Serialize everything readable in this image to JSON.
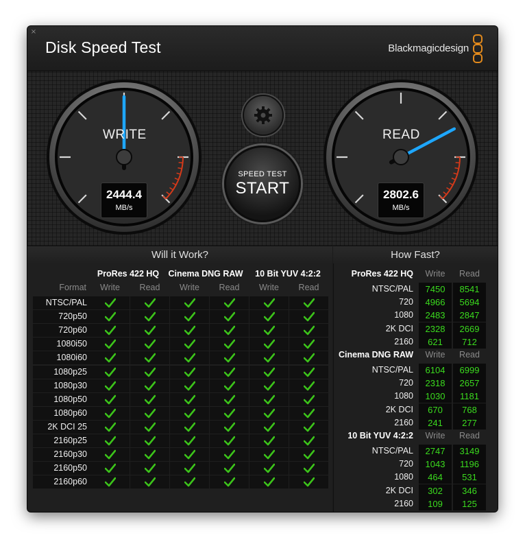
{
  "window": {
    "title": "Disk Speed Test",
    "brand": "Blackmagicdesign",
    "close_glyph": "×"
  },
  "colors": {
    "accent_needle": "#1ea7ff",
    "value_green": "#3bdb1e",
    "check_green": "#3cc31a",
    "redline": "#d53a1a"
  },
  "gauges": {
    "write": {
      "label": "WRITE",
      "value": "2444.4",
      "unit": "MB/s",
      "needle_fraction": 0.5
    },
    "read": {
      "label": "READ",
      "value": "2802.6",
      "unit": "MB/s",
      "needle_fraction": 0.73
    }
  },
  "controls": {
    "settings_icon": "gear-icon",
    "start_sub": "SPEED TEST",
    "start_main": "START"
  },
  "will_it_work": {
    "title": "Will it Work?",
    "groups": [
      "ProRes 422 HQ",
      "Cinema DNG RAW",
      "10 Bit YUV 4:2:2"
    ],
    "format_label": "Format",
    "write_label": "Write",
    "read_label": "Read",
    "rows": [
      "NTSC/PAL",
      "720p50",
      "720p60",
      "1080i50",
      "1080i60",
      "1080p25",
      "1080p30",
      "1080p50",
      "1080p60",
      "2K DCI 25",
      "2160p25",
      "2160p30",
      "2160p50",
      "2160p60"
    ]
  },
  "how_fast": {
    "title": "How Fast?",
    "write_label": "Write",
    "read_label": "Read",
    "groups": [
      {
        "name": "ProRes 422 HQ",
        "rows": [
          {
            "label": "NTSC/PAL",
            "write": "7450",
            "read": "8541"
          },
          {
            "label": "720",
            "write": "4966",
            "read": "5694"
          },
          {
            "label": "1080",
            "write": "2483",
            "read": "2847"
          },
          {
            "label": "2K DCI",
            "write": "2328",
            "read": "2669"
          },
          {
            "label": "2160",
            "write": "621",
            "read": "712"
          }
        ]
      },
      {
        "name": "Cinema DNG RAW",
        "rows": [
          {
            "label": "NTSC/PAL",
            "write": "6104",
            "read": "6999"
          },
          {
            "label": "720",
            "write": "2318",
            "read": "2657"
          },
          {
            "label": "1080",
            "write": "1030",
            "read": "1181"
          },
          {
            "label": "2K DCI",
            "write": "670",
            "read": "768"
          },
          {
            "label": "2160",
            "write": "241",
            "read": "277"
          }
        ]
      },
      {
        "name": "10 Bit YUV 4:2:2",
        "rows": [
          {
            "label": "NTSC/PAL",
            "write": "2747",
            "read": "3149"
          },
          {
            "label": "720",
            "write": "1043",
            "read": "1196"
          },
          {
            "label": "1080",
            "write": "464",
            "read": "531"
          },
          {
            "label": "2K DCI",
            "write": "302",
            "read": "346"
          },
          {
            "label": "2160",
            "write": "109",
            "read": "125"
          }
        ]
      }
    ]
  }
}
